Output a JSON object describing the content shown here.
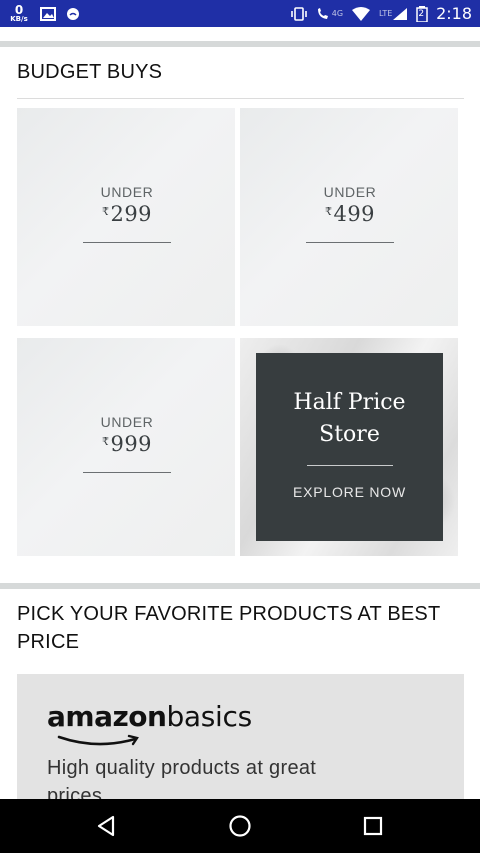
{
  "status_bar": {
    "data_speed": "0",
    "data_unit": "KB/s",
    "network_label": "4G",
    "lte_label": "LTE",
    "battery_level": "2",
    "time": "2:18",
    "icons": [
      "image-icon",
      "app-notification-icon",
      "vibrate-icon",
      "wifi-calling-icon",
      "wifi-icon",
      "signal-icon",
      "battery-icon"
    ]
  },
  "budget_buys": {
    "title": "BUDGET BUYS",
    "tiles": [
      {
        "prefix": "UNDER",
        "currency": "₹",
        "amount": "299"
      },
      {
        "prefix": "UNDER",
        "currency": "₹",
        "amount": "499"
      },
      {
        "prefix": "UNDER",
        "currency": "₹",
        "amount": "999"
      }
    ],
    "promo": {
      "title": "Half Price Store",
      "cta": "EXPLORE NOW"
    }
  },
  "favorites": {
    "title": "PICK YOUR FAVORITE PRODUCTS AT BEST PRICE",
    "banner": {
      "brand_bold": "amazon",
      "brand_light": "basics",
      "tagline": "High quality products at great prices"
    }
  },
  "nav_bar": {
    "icons": [
      "back-icon",
      "home-icon",
      "recents-icon"
    ]
  },
  "colors": {
    "status_bar": "#1f2fa6",
    "promo_card": "#373d3f",
    "divider": "#d6d9d9"
  }
}
